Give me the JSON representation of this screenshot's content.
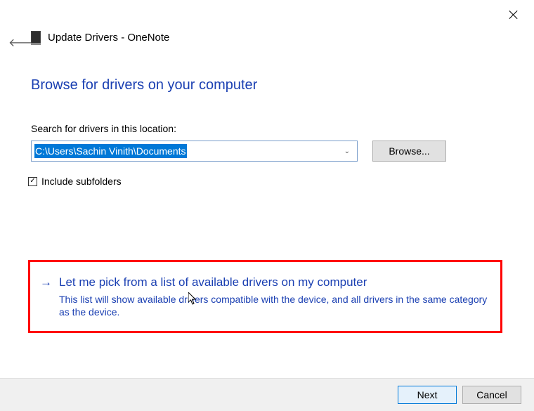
{
  "window": {
    "title": "Update Drivers - OneNote"
  },
  "heading": "Browse for drivers on your computer",
  "search": {
    "label": "Search for drivers in this location:",
    "path": "C:\\Users\\Sachin Vinith\\Documents",
    "browse_label": "Browse..."
  },
  "checkbox": {
    "checked_glyph": "☑",
    "label": "Include subfolders",
    "checked": true
  },
  "pick_option": {
    "arrow": "→",
    "title": "Let me pick from a list of available drivers on my computer",
    "description": "This list will show available drivers compatible with the device, and all drivers in the same category as the device."
  },
  "buttons": {
    "next": "Next",
    "cancel": "Cancel"
  }
}
